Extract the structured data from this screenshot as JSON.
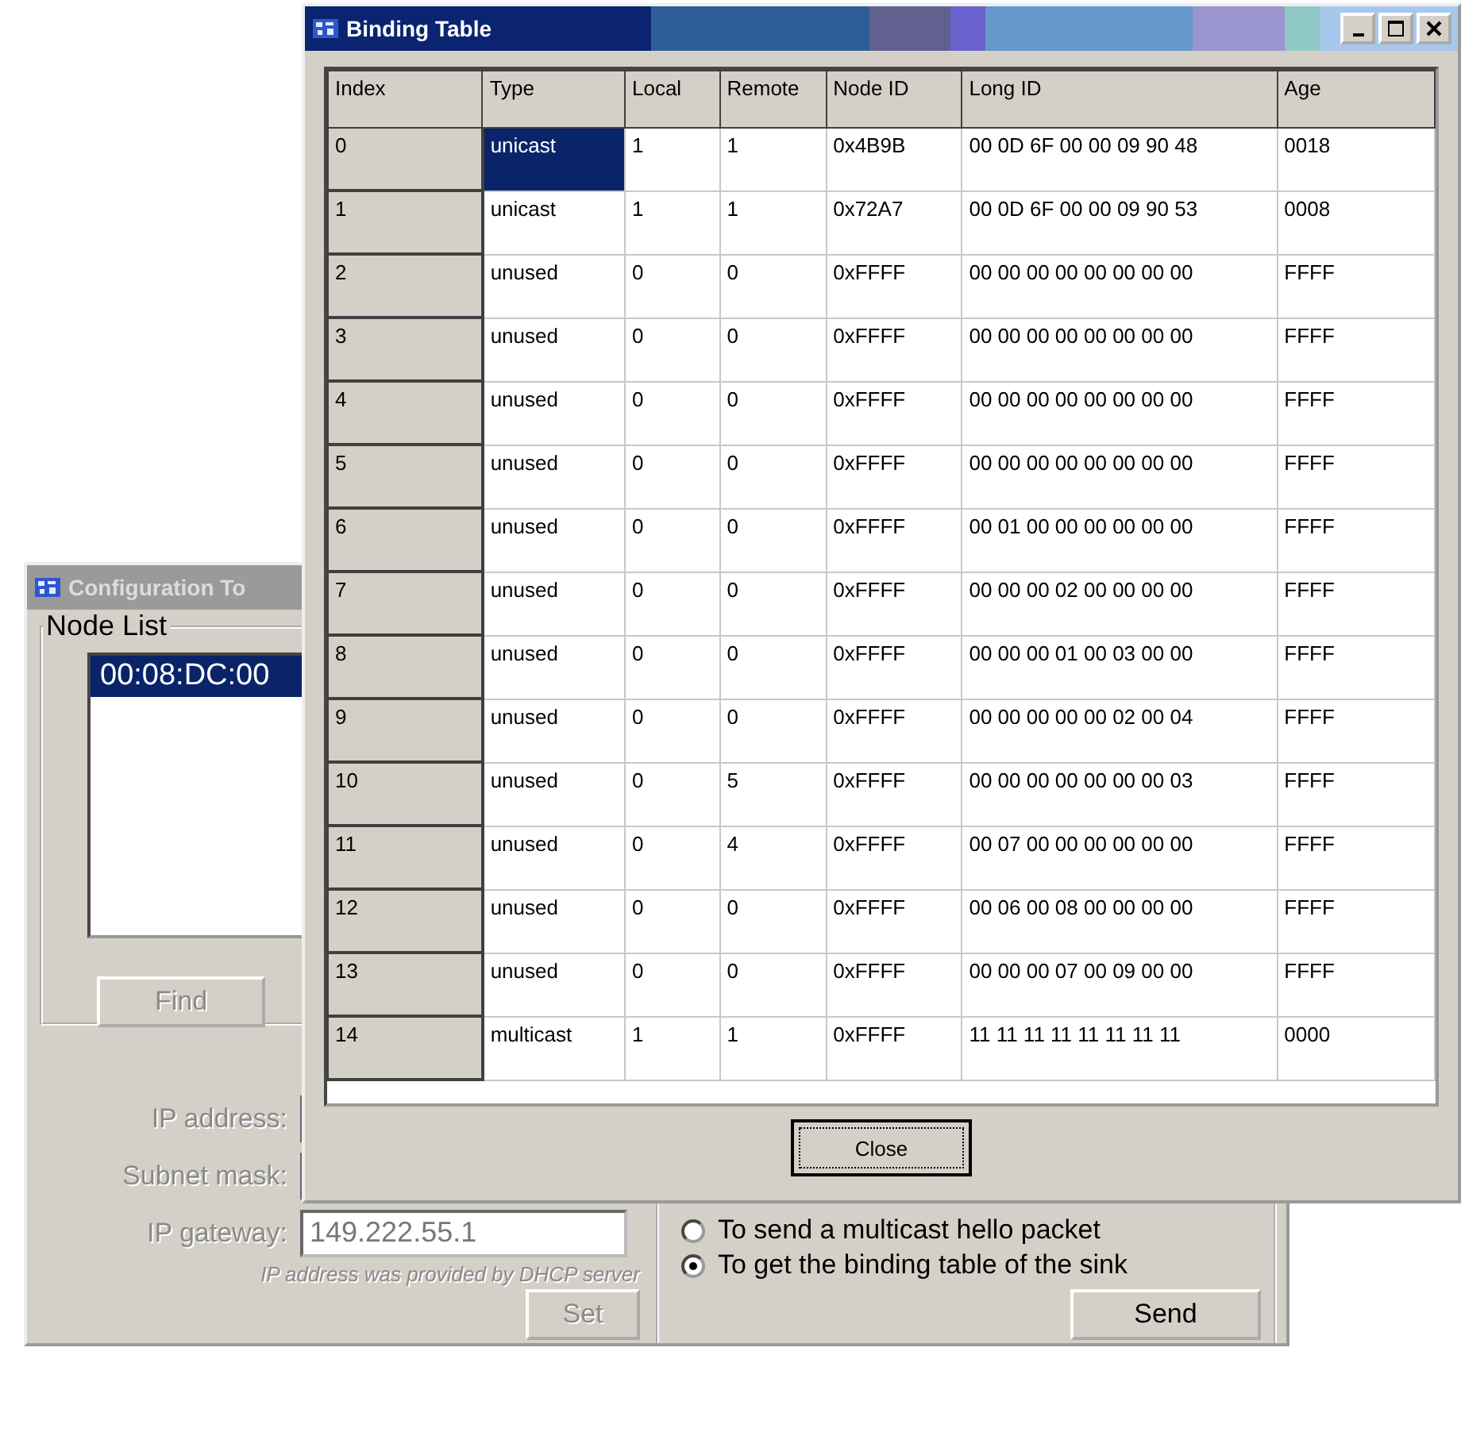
{
  "config_window": {
    "title": "Configuration To",
    "node_list": {
      "legend": "Node List",
      "items": [
        {
          "label": "00:08:DC:00",
          "selected": true
        }
      ]
    },
    "find_button": {
      "label": "Find",
      "disabled": true
    },
    "fields": [
      {
        "label": "IP address:",
        "disabled": true
      },
      {
        "label": "Subnet mask:",
        "disabled": true
      },
      {
        "label": "IP gateway:",
        "value": "149.222.55.1",
        "disabled": true
      }
    ],
    "note": "IP address was provided by DHCP server",
    "set_button": {
      "label": "Set",
      "disabled": true
    },
    "radios": [
      {
        "label": "To send a multicast hello packet",
        "selected": false
      },
      {
        "label": "To get the binding table of the sink",
        "selected": true
      }
    ],
    "send_button": {
      "label": "Send",
      "disabled": false
    }
  },
  "binding_window": {
    "title": "Binding Table",
    "columns": [
      "Index",
      "Type",
      "Local",
      "Remote",
      "Node ID",
      "Long ID",
      "Age"
    ],
    "rows": [
      {
        "cells": [
          "0",
          "unicast",
          "1",
          "1",
          "0x4B9B",
          "00 0D 6F 00 00 09 90 48",
          "0018"
        ],
        "selected": true
      },
      {
        "cells": [
          "1",
          "unicast",
          "1",
          "1",
          "0x72A7",
          "00 0D 6F 00 00 09 90 53",
          "0008"
        ],
        "selected": false
      },
      {
        "cells": [
          "2",
          "unused",
          "0",
          "0",
          "0xFFFF",
          "00 00 00 00 00 00 00 00",
          "FFFF"
        ],
        "selected": false
      },
      {
        "cells": [
          "3",
          "unused",
          "0",
          "0",
          "0xFFFF",
          "00 00 00 00 00 00 00 00",
          "FFFF"
        ],
        "selected": false
      },
      {
        "cells": [
          "4",
          "unused",
          "0",
          "0",
          "0xFFFF",
          "00 00 00 00 00 00 00 00",
          "FFFF"
        ],
        "selected": false
      },
      {
        "cells": [
          "5",
          "unused",
          "0",
          "0",
          "0xFFFF",
          "00 00 00 00 00 00 00 00",
          "FFFF"
        ],
        "selected": false
      },
      {
        "cells": [
          "6",
          "unused",
          "0",
          "0",
          "0xFFFF",
          "00 01 00 00 00 00 00 00",
          "FFFF"
        ],
        "selected": false
      },
      {
        "cells": [
          "7",
          "unused",
          "0",
          "0",
          "0xFFFF",
          "00 00 00 02 00 00 00 00",
          "FFFF"
        ],
        "selected": false
      },
      {
        "cells": [
          "8",
          "unused",
          "0",
          "0",
          "0xFFFF",
          "00 00 00 01 00 03 00 00",
          "FFFF"
        ],
        "selected": false
      },
      {
        "cells": [
          "9",
          "unused",
          "0",
          "0",
          "0xFFFF",
          "00 00 00 00 00 02 00 04",
          "FFFF"
        ],
        "selected": false
      },
      {
        "cells": [
          "10",
          "unused",
          "0",
          "5",
          "0xFFFF",
          "00 00 00 00 00 00 00 03",
          "FFFF"
        ],
        "selected": false
      },
      {
        "cells": [
          "11",
          "unused",
          "0",
          "4",
          "0xFFFF",
          "00 07 00 00 00 00 00 00",
          "FFFF"
        ],
        "selected": false
      },
      {
        "cells": [
          "12",
          "unused",
          "0",
          "0",
          "0xFFFF",
          "00 06 00 08 00 00 00 00",
          "FFFF"
        ],
        "selected": false
      },
      {
        "cells": [
          "13",
          "unused",
          "0",
          "0",
          "0xFFFF",
          "00 00 00 07 00 09 00 00",
          "FFFF"
        ],
        "selected": false
      },
      {
        "cells": [
          "14",
          "multicast",
          "1",
          "1",
          "0xFFFF",
          "11 11 11 11 11 11 11 11",
          "0000"
        ],
        "selected": false
      }
    ],
    "close_button": {
      "label": "Close"
    }
  }
}
